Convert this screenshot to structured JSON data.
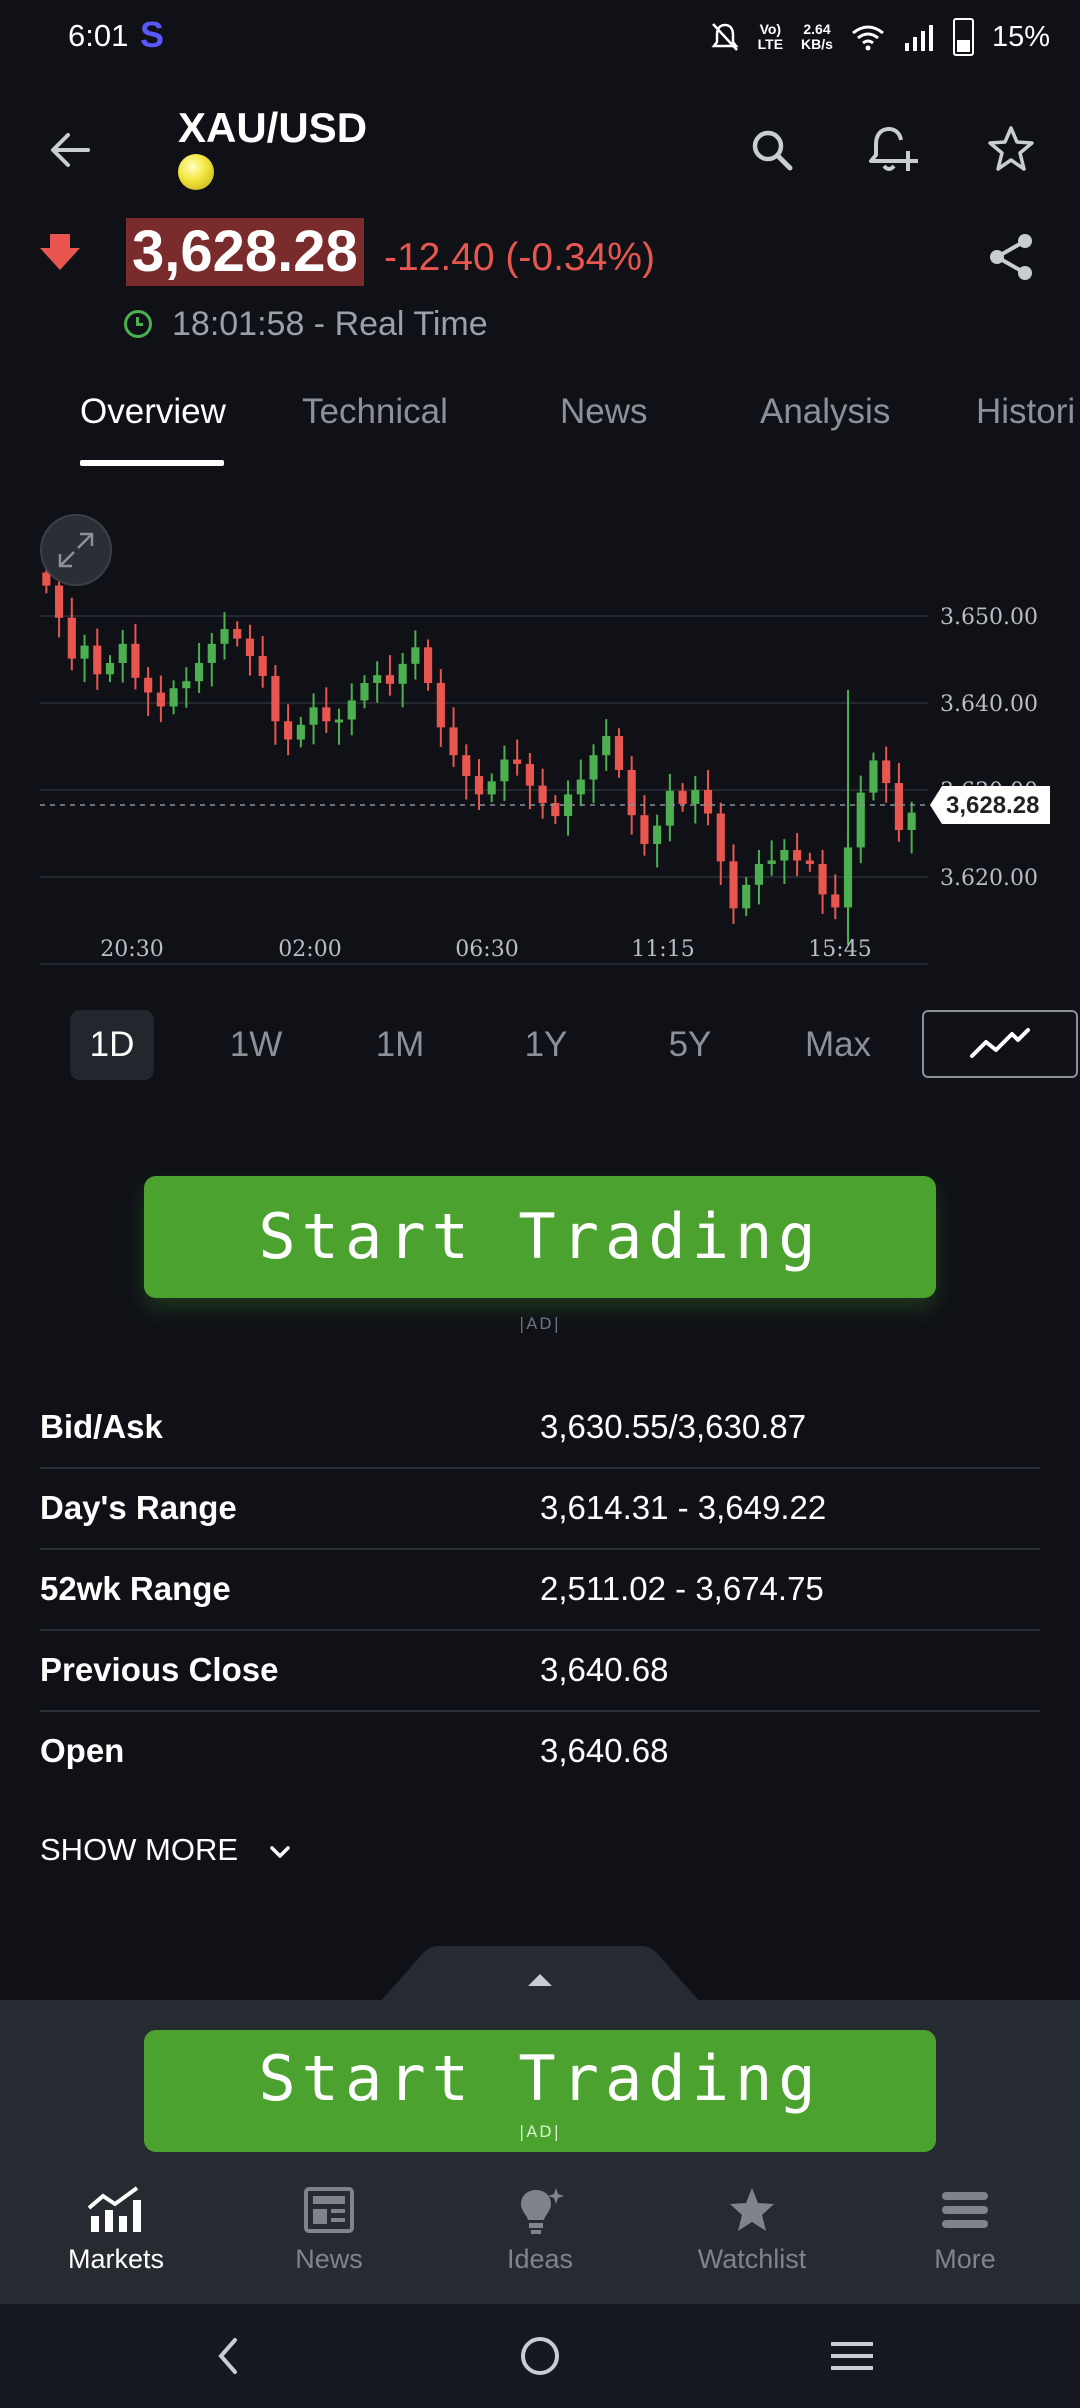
{
  "status_bar": {
    "time": "6:01",
    "app_badge": "S",
    "net_speed_top": "2.64",
    "net_speed_bottom": "KB/s",
    "volte_top": "Vo)",
    "volte_bottom": "LTE",
    "battery": "15%"
  },
  "header": {
    "symbol": "XAU/USD",
    "price": "3,628.28",
    "change": "-12.40 (-0.34%)",
    "time_text": "18:01:58 - Real Time"
  },
  "tabs": [
    {
      "label": "Overview",
      "active": true
    },
    {
      "label": "Technical"
    },
    {
      "label": "News"
    },
    {
      "label": "Analysis"
    },
    {
      "label": "Histori"
    }
  ],
  "chart_data": {
    "type": "candlestick",
    "x_ticks": [
      "20:30",
      "02:00",
      "06:30",
      "11:15",
      "15:45"
    ],
    "y_ticks": [
      "3,650.00",
      "3,640.00",
      "3,630.00",
      "3,620.00"
    ],
    "y_tick_display": [
      "3.650.00",
      "3.640.00",
      "3.630.00",
      "3.620.00"
    ],
    "ylim": [
      3612,
      3656
    ],
    "current_price": 3628.28,
    "current_price_label": "3,628.28",
    "up_color": "#4caf50",
    "down_color": "#e9564f",
    "closes": [
      3653.5,
      3649.8,
      3645.1,
      3646.6,
      3643.3,
      3644.6,
      3646.8,
      3642.9,
      3641.2,
      3639.6,
      3641.7,
      3642.5,
      3644.6,
      3646.8,
      3648.5,
      3647.4,
      3645.4,
      3643.1,
      3637.9,
      3635.8,
      3637.5,
      3639.5,
      3637.9,
      3638.1,
      3640.3,
      3642.3,
      3643.2,
      3642.2,
      3644.5,
      3646.4,
      3642.3,
      3637.2,
      3634.0,
      3631.6,
      3629.5,
      3631.0,
      3633.5,
      3633.0,
      3630.5,
      3628.5,
      3627.0,
      3629.5,
      3631.2,
      3634.0,
      3636.2,
      3632.3,
      3627.1,
      3623.8,
      3625.9,
      3629.9,
      3628.4,
      3630.0,
      3627.3,
      3621.8,
      3616.4,
      3619.1,
      3621.5,
      3621.9,
      3623.1,
      3621.9,
      3621.5,
      3618.0,
      3616.5,
      3623.4,
      3629.7,
      3633.4,
      3630.8,
      3625.4,
      3627.4
    ],
    "opens": [
      3655.0,
      3653.5,
      3649.8,
      3645.1,
      3646.6,
      3643.3,
      3644.6,
      3646.8,
      3642.9,
      3641.2,
      3639.6,
      3641.7,
      3642.5,
      3644.6,
      3646.8,
      3648.5,
      3647.4,
      3645.4,
      3643.1,
      3637.9,
      3635.8,
      3637.5,
      3639.5,
      3637.9,
      3638.1,
      3640.3,
      3642.3,
      3643.2,
      3642.2,
      3644.5,
      3646.4,
      3642.3,
      3637.2,
      3634.0,
      3631.6,
      3629.5,
      3631.0,
      3633.5,
      3633.0,
      3630.5,
      3628.5,
      3627.0,
      3629.5,
      3631.2,
      3634.0,
      3636.2,
      3632.3,
      3627.1,
      3623.8,
      3625.9,
      3629.9,
      3628.4,
      3630.0,
      3627.3,
      3621.8,
      3616.4,
      3619.1,
      3621.5,
      3621.9,
      3623.1,
      3621.9,
      3621.5,
      3618.0,
      3616.5,
      3623.4,
      3629.7,
      3633.4,
      3630.8,
      3625.4
    ]
  },
  "periods": [
    {
      "label": "1D",
      "active": true
    },
    {
      "label": "1W"
    },
    {
      "label": "1M"
    },
    {
      "label": "1Y"
    },
    {
      "label": "5Y"
    },
    {
      "label": "Max"
    }
  ],
  "ad": {
    "label": "Start Trading",
    "tag": "|AD|"
  },
  "stats": [
    {
      "label": "Bid/Ask",
      "value": "3,630.55/3,630.87"
    },
    {
      "label": "Day's Range",
      "value": "3,614.31 - 3,649.22"
    },
    {
      "label": "52wk Range",
      "value": "2,511.02 - 3,674.75"
    },
    {
      "label": "Previous Close",
      "value": "3,640.68"
    },
    {
      "label": "Open",
      "value": "3,640.68"
    }
  ],
  "show_more": "SHOW MORE",
  "bottom_nav": [
    {
      "label": "Markets",
      "icon": "markets-icon",
      "active": true
    },
    {
      "label": "News",
      "icon": "news-icon"
    },
    {
      "label": "Ideas",
      "icon": "ideas-icon"
    },
    {
      "label": "Watchlist",
      "icon": "watchlist-icon"
    },
    {
      "label": "More",
      "icon": "menu-icon"
    }
  ],
  "colors": {
    "background": "#0f1117",
    "accent_green": "#4ca22f",
    "negative": "#e9564f",
    "price_highlight": "#7a2c2c"
  }
}
